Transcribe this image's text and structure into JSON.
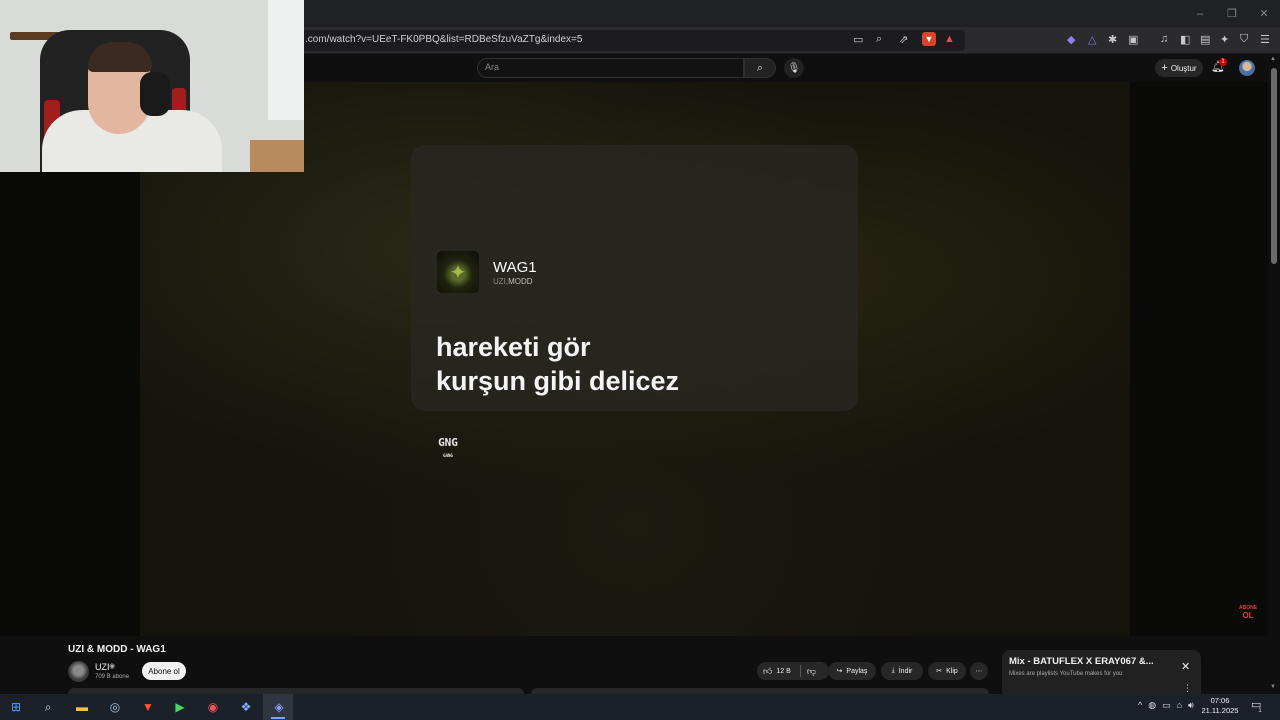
{
  "browser": {
    "url": ".com/watch?v=UEeT-FK0PBQ&list=RDBeSfzuVaZTg&index=5",
    "window_controls": [
      "–",
      "❐",
      "✕"
    ],
    "toolbar_icons": [
      "cast-icon",
      "zoom-icon",
      "share-icon",
      "brave-shield-icon",
      "brave-rewards-icon",
      "leo-icon",
      "wallet-vpn-icon",
      "extensions-icon",
      "screenshot-icon",
      "media-icon",
      "sidebar-icon",
      "wallet-icon",
      "leo-ai-icon",
      "shield-icon",
      "menu-icon"
    ]
  },
  "youtube": {
    "search_placeholder": "Ara",
    "create_label": "Oluştur",
    "notification_count": "1"
  },
  "player": {
    "song_title": "WAG1",
    "artist_dim": "UZI,",
    "artist": "MODD",
    "lyric_line_1": "hareketi gör",
    "lyric_line_2": "kurşun gibi delicez",
    "logo_line_1": "GNG",
    "logo_line_2": "GANG",
    "badge_line_1": "ABONE",
    "badge_line_2": "OL"
  },
  "video": {
    "title": "UZI & MODD - WAG1",
    "channel": "UZI",
    "subscribers": "709 B abone",
    "subscribe_label": "Abone ol",
    "likes": "12 B",
    "share_label": "Paylaş",
    "download_label": "İndir",
    "clip_label": "Klip"
  },
  "mix": {
    "title": "Mix - BATUFLEX X ERAY067 &...",
    "subtitle": "Mixes are playlists YouTube makes for you"
  },
  "taskbar": {
    "time": "07:06",
    "date": "21.11.2025",
    "notification_count": "1"
  }
}
